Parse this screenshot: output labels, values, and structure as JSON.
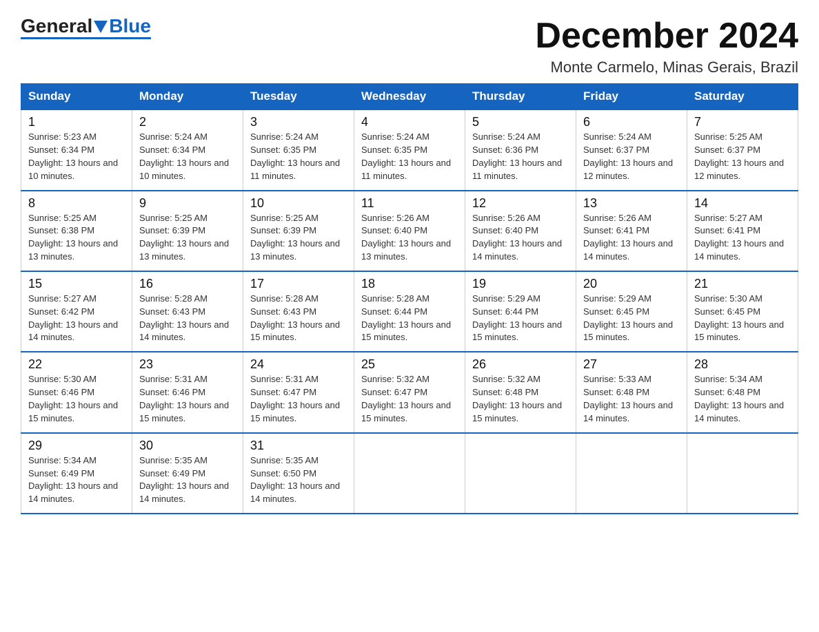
{
  "logo": {
    "general": "General",
    "blue": "Blue"
  },
  "title": "December 2024",
  "subtitle": "Monte Carmelo, Minas Gerais, Brazil",
  "days_of_week": [
    "Sunday",
    "Monday",
    "Tuesday",
    "Wednesday",
    "Thursday",
    "Friday",
    "Saturday"
  ],
  "weeks": [
    [
      {
        "day": "1",
        "sunrise": "Sunrise: 5:23 AM",
        "sunset": "Sunset: 6:34 PM",
        "daylight": "Daylight: 13 hours and 10 minutes."
      },
      {
        "day": "2",
        "sunrise": "Sunrise: 5:24 AM",
        "sunset": "Sunset: 6:34 PM",
        "daylight": "Daylight: 13 hours and 10 minutes."
      },
      {
        "day": "3",
        "sunrise": "Sunrise: 5:24 AM",
        "sunset": "Sunset: 6:35 PM",
        "daylight": "Daylight: 13 hours and 11 minutes."
      },
      {
        "day": "4",
        "sunrise": "Sunrise: 5:24 AM",
        "sunset": "Sunset: 6:35 PM",
        "daylight": "Daylight: 13 hours and 11 minutes."
      },
      {
        "day": "5",
        "sunrise": "Sunrise: 5:24 AM",
        "sunset": "Sunset: 6:36 PM",
        "daylight": "Daylight: 13 hours and 11 minutes."
      },
      {
        "day": "6",
        "sunrise": "Sunrise: 5:24 AM",
        "sunset": "Sunset: 6:37 PM",
        "daylight": "Daylight: 13 hours and 12 minutes."
      },
      {
        "day": "7",
        "sunrise": "Sunrise: 5:25 AM",
        "sunset": "Sunset: 6:37 PM",
        "daylight": "Daylight: 13 hours and 12 minutes."
      }
    ],
    [
      {
        "day": "8",
        "sunrise": "Sunrise: 5:25 AM",
        "sunset": "Sunset: 6:38 PM",
        "daylight": "Daylight: 13 hours and 13 minutes."
      },
      {
        "day": "9",
        "sunrise": "Sunrise: 5:25 AM",
        "sunset": "Sunset: 6:39 PM",
        "daylight": "Daylight: 13 hours and 13 minutes."
      },
      {
        "day": "10",
        "sunrise": "Sunrise: 5:25 AM",
        "sunset": "Sunset: 6:39 PM",
        "daylight": "Daylight: 13 hours and 13 minutes."
      },
      {
        "day": "11",
        "sunrise": "Sunrise: 5:26 AM",
        "sunset": "Sunset: 6:40 PM",
        "daylight": "Daylight: 13 hours and 13 minutes."
      },
      {
        "day": "12",
        "sunrise": "Sunrise: 5:26 AM",
        "sunset": "Sunset: 6:40 PM",
        "daylight": "Daylight: 13 hours and 14 minutes."
      },
      {
        "day": "13",
        "sunrise": "Sunrise: 5:26 AM",
        "sunset": "Sunset: 6:41 PM",
        "daylight": "Daylight: 13 hours and 14 minutes."
      },
      {
        "day": "14",
        "sunrise": "Sunrise: 5:27 AM",
        "sunset": "Sunset: 6:41 PM",
        "daylight": "Daylight: 13 hours and 14 minutes."
      }
    ],
    [
      {
        "day": "15",
        "sunrise": "Sunrise: 5:27 AM",
        "sunset": "Sunset: 6:42 PM",
        "daylight": "Daylight: 13 hours and 14 minutes."
      },
      {
        "day": "16",
        "sunrise": "Sunrise: 5:28 AM",
        "sunset": "Sunset: 6:43 PM",
        "daylight": "Daylight: 13 hours and 14 minutes."
      },
      {
        "day": "17",
        "sunrise": "Sunrise: 5:28 AM",
        "sunset": "Sunset: 6:43 PM",
        "daylight": "Daylight: 13 hours and 15 minutes."
      },
      {
        "day": "18",
        "sunrise": "Sunrise: 5:28 AM",
        "sunset": "Sunset: 6:44 PM",
        "daylight": "Daylight: 13 hours and 15 minutes."
      },
      {
        "day": "19",
        "sunrise": "Sunrise: 5:29 AM",
        "sunset": "Sunset: 6:44 PM",
        "daylight": "Daylight: 13 hours and 15 minutes."
      },
      {
        "day": "20",
        "sunrise": "Sunrise: 5:29 AM",
        "sunset": "Sunset: 6:45 PM",
        "daylight": "Daylight: 13 hours and 15 minutes."
      },
      {
        "day": "21",
        "sunrise": "Sunrise: 5:30 AM",
        "sunset": "Sunset: 6:45 PM",
        "daylight": "Daylight: 13 hours and 15 minutes."
      }
    ],
    [
      {
        "day": "22",
        "sunrise": "Sunrise: 5:30 AM",
        "sunset": "Sunset: 6:46 PM",
        "daylight": "Daylight: 13 hours and 15 minutes."
      },
      {
        "day": "23",
        "sunrise": "Sunrise: 5:31 AM",
        "sunset": "Sunset: 6:46 PM",
        "daylight": "Daylight: 13 hours and 15 minutes."
      },
      {
        "day": "24",
        "sunrise": "Sunrise: 5:31 AM",
        "sunset": "Sunset: 6:47 PM",
        "daylight": "Daylight: 13 hours and 15 minutes."
      },
      {
        "day": "25",
        "sunrise": "Sunrise: 5:32 AM",
        "sunset": "Sunset: 6:47 PM",
        "daylight": "Daylight: 13 hours and 15 minutes."
      },
      {
        "day": "26",
        "sunrise": "Sunrise: 5:32 AM",
        "sunset": "Sunset: 6:48 PM",
        "daylight": "Daylight: 13 hours and 15 minutes."
      },
      {
        "day": "27",
        "sunrise": "Sunrise: 5:33 AM",
        "sunset": "Sunset: 6:48 PM",
        "daylight": "Daylight: 13 hours and 14 minutes."
      },
      {
        "day": "28",
        "sunrise": "Sunrise: 5:34 AM",
        "sunset": "Sunset: 6:48 PM",
        "daylight": "Daylight: 13 hours and 14 minutes."
      }
    ],
    [
      {
        "day": "29",
        "sunrise": "Sunrise: 5:34 AM",
        "sunset": "Sunset: 6:49 PM",
        "daylight": "Daylight: 13 hours and 14 minutes."
      },
      {
        "day": "30",
        "sunrise": "Sunrise: 5:35 AM",
        "sunset": "Sunset: 6:49 PM",
        "daylight": "Daylight: 13 hours and 14 minutes."
      },
      {
        "day": "31",
        "sunrise": "Sunrise: 5:35 AM",
        "sunset": "Sunset: 6:50 PM",
        "daylight": "Daylight: 13 hours and 14 minutes."
      },
      {
        "day": "",
        "sunrise": "",
        "sunset": "",
        "daylight": ""
      },
      {
        "day": "",
        "sunrise": "",
        "sunset": "",
        "daylight": ""
      },
      {
        "day": "",
        "sunrise": "",
        "sunset": "",
        "daylight": ""
      },
      {
        "day": "",
        "sunrise": "",
        "sunset": "",
        "daylight": ""
      }
    ]
  ]
}
